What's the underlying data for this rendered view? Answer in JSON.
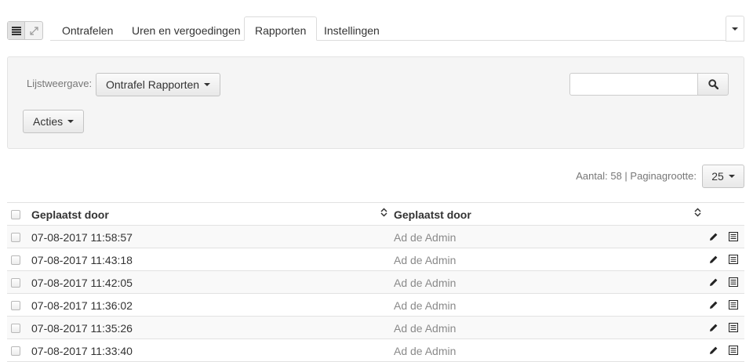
{
  "tabs": [
    {
      "label": "Ontrafelen",
      "active": false
    },
    {
      "label": "Uren en vergoedingen",
      "active": false
    },
    {
      "label": "Rapporten",
      "active": true
    },
    {
      "label": "Instellingen",
      "active": false
    }
  ],
  "filter": {
    "list_view_label": "Lijstweergave:",
    "list_view_value": "Ontrafel Rapporten",
    "actions_label": "Acties",
    "search_placeholder": "",
    "search_value": ""
  },
  "pagination": {
    "count_text": "Aantal: 58 |",
    "page_size_label": "Paginagrootte:",
    "page_size_value": "25"
  },
  "table": {
    "columns": [
      "Geplaatst door",
      "Geplaatst door"
    ],
    "rows": [
      {
        "date": "07-08-2017 11:58:57",
        "by": "Ad de Admin"
      },
      {
        "date": "07-08-2017 11:43:18",
        "by": "Ad de Admin"
      },
      {
        "date": "07-08-2017 11:42:05",
        "by": "Ad de Admin"
      },
      {
        "date": "07-08-2017 11:36:02",
        "by": "Ad de Admin"
      },
      {
        "date": "07-08-2017 11:35:26",
        "by": "Ad de Admin"
      },
      {
        "date": "07-08-2017 11:33:40",
        "by": "Ad de Admin"
      }
    ]
  },
  "icons": {
    "list_view": "list-icon",
    "expand": "expand-icon",
    "search": "search-icon",
    "sort": "sort-icon",
    "edit": "pencil-icon",
    "details": "details-icon"
  }
}
